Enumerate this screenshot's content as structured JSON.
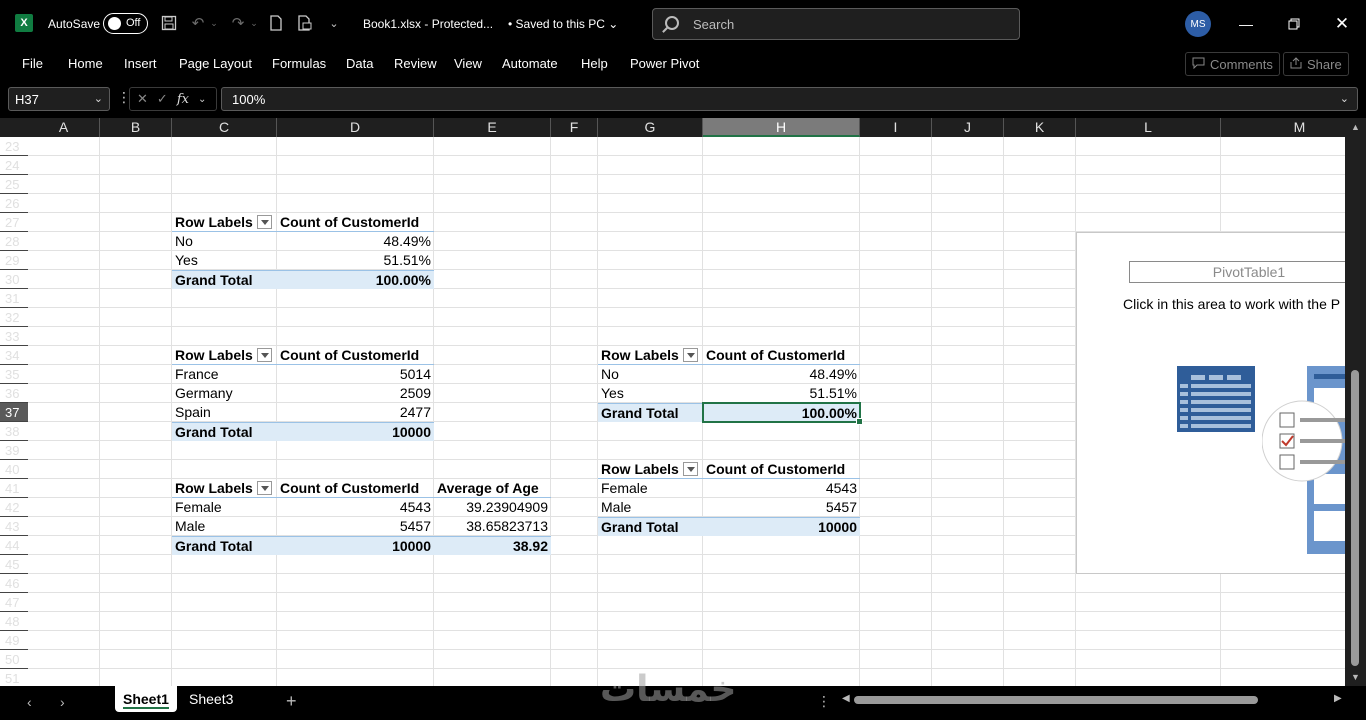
{
  "titlebar": {
    "autosave_label": "AutoSave",
    "autosave_state": "Off",
    "filename": "Book1.xlsx  -  Protected...",
    "save_state": "• Saved to this PC ⌄",
    "search_placeholder": "Search",
    "user_initials": "MS"
  },
  "ribbon": {
    "tabs": [
      "File",
      "Home",
      "Insert",
      "Page Layout",
      "Formulas",
      "Data",
      "Review",
      "View",
      "Automate",
      "Help",
      "Power Pivot"
    ],
    "comments_label": "Comments",
    "share_label": "Share"
  },
  "formula_bar": {
    "name_box": "H37",
    "fx_symbol": "fx",
    "value": "100%"
  },
  "columns": [
    "A",
    "B",
    "C",
    "D",
    "E",
    "F",
    "G",
    "H",
    "I",
    "J",
    "K",
    "L",
    "M"
  ],
  "selected_column": "H",
  "rows": [
    "23",
    "24",
    "25",
    "26",
    "27",
    "28",
    "29",
    "30",
    "31",
    "32",
    "33",
    "34",
    "35",
    "36",
    "37",
    "38",
    "39",
    "40",
    "41",
    "42",
    "43",
    "44",
    "45",
    "46",
    "47",
    "48",
    "49",
    "50",
    "51"
  ],
  "selected_row": "37",
  "pivot1": {
    "h1": "Row Labels",
    "h2": "Count of CustomerId",
    "r1l": "No",
    "r1v": "48.49%",
    "r2l": "Yes",
    "r2v": "51.51%",
    "tl": "Grand Total",
    "tv": "100.00%"
  },
  "pivot2": {
    "h1": "Row Labels",
    "h2": "Count of CustomerId",
    "r1l": "France",
    "r1v": "5014",
    "r2l": "Germany",
    "r2v": "2509",
    "r3l": "Spain",
    "r3v": "2477",
    "tl": "Grand Total",
    "tv": "10000"
  },
  "pivot3": {
    "h1": "Row Labels",
    "h2": "Count of CustomerId",
    "h3": "Average of Age",
    "r1l": "Female",
    "r1v": "4543",
    "r1a": "39.23904909",
    "r2l": "Male",
    "r2v": "5457",
    "r2a": "38.65823713",
    "tl": "Grand Total",
    "tv": "10000",
    "ta": "38.92"
  },
  "pivot4": {
    "h1": "Row Labels",
    "h2": "Count of CustomerId",
    "r1l": "No",
    "r1v": "48.49%",
    "r2l": "Yes",
    "r2v": "51.51%",
    "tl": "Grand Total",
    "tv": "100.00%"
  },
  "pivot5": {
    "h1": "Row Labels",
    "h2": "Count of CustomerId",
    "r1l": "Female",
    "r1v": "4543",
    "r2l": "Male",
    "r2v": "5457",
    "tl": "Grand Total",
    "tv": "10000"
  },
  "pivot_placeholder": {
    "name": "PivotTable1",
    "hint": "Click in this area to work with the P"
  },
  "sheets": {
    "s1": "Sheet1",
    "s2": "Sheet3",
    "active": "Sheet1"
  },
  "watermark": "خمسات"
}
